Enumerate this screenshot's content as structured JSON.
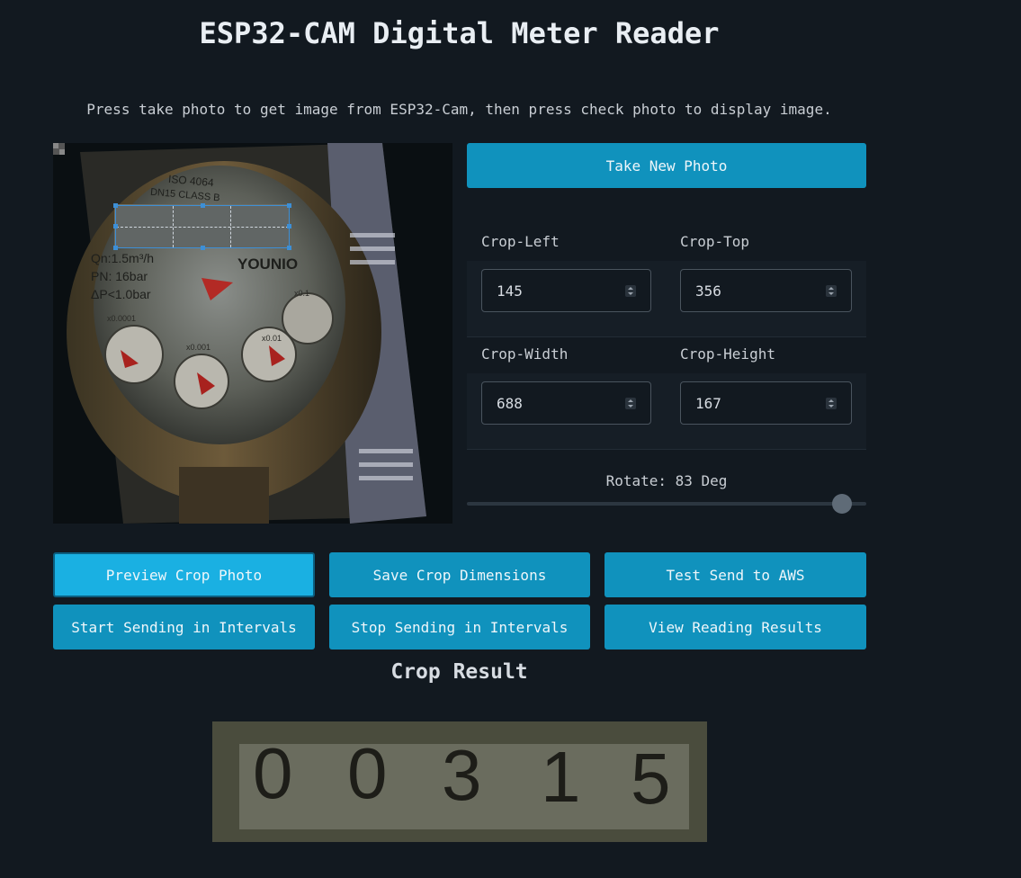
{
  "header": {
    "title": "ESP32-CAM Digital Meter Reader",
    "subtitle": "Press take photo to get image from ESP32-Cam, then press check photo to display image."
  },
  "controls": {
    "take_photo_label": "Take New Photo",
    "crop_left_label": "Crop-Left",
    "crop_top_label": "Crop-Top",
    "crop_width_label": "Crop-Width",
    "crop_height_label": "Crop-Height",
    "crop_left_value": "145",
    "crop_top_value": "356",
    "crop_width_value": "688",
    "crop_height_value": "167",
    "rotate_label": "Rotate: 83 Deg",
    "rotate_value": 83
  },
  "buttons": {
    "preview": "Preview Crop Photo",
    "save": "Save Crop Dimensions",
    "test_aws": "Test Send to AWS",
    "start_intervals": "Start Sending in Intervals",
    "stop_intervals": "Stop Sending in Intervals",
    "view_results": "View Reading Results"
  },
  "result": {
    "title": "Crop Result",
    "meter_digits": [
      "0",
      "0",
      "3",
      "1",
      "5"
    ]
  },
  "photo": {
    "dial_labels": [
      "ISO 4064",
      "DN15 CLASS B",
      "Qn:1.5m³/h",
      "PN: 16bar",
      "ΔP<1.0bar",
      "YOUNIO",
      "x0.0001",
      "x0.001",
      "x0.01",
      "x0.1"
    ]
  },
  "colors": {
    "background": "#121920",
    "button": "#1092bd",
    "button_active": "#1ab0e2",
    "crop_box": "#3d8fd6"
  }
}
